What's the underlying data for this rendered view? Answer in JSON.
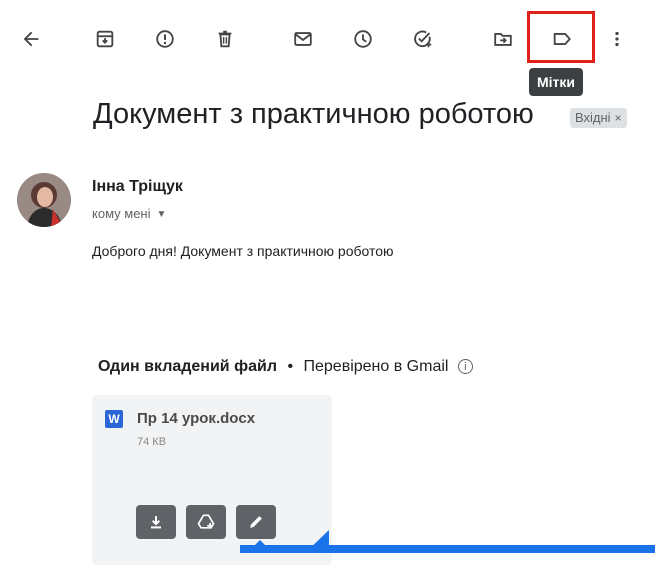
{
  "toolbar": {
    "back": "back-arrow-icon",
    "archive": "archive-icon",
    "report_spam": "report-spam-icon",
    "delete": "trash-icon",
    "mark_unread": "mail-icon",
    "snooze": "clock-icon",
    "add_task": "add-task-icon",
    "move_to": "move-to-folder-icon",
    "labels": "label-icon",
    "more": "more-vert-icon",
    "tooltip": "Мітки",
    "highlight_color": "#e0201b"
  },
  "email": {
    "subject": "Документ з практичною роботою",
    "label_chip": "Вхідні",
    "label_chip_close": "×",
    "sender": "Інна Тріщук",
    "recipient": "кому мені",
    "body": "Доброго дня! Документ з практичною роботою"
  },
  "attachments": {
    "header_bold": "Один вкладений файл",
    "separator": "•",
    "scan_status": "Перевірено в Gmail",
    "info_glyph": "i",
    "file": {
      "type_letter": "W",
      "name": "Пр 14 урок.docx",
      "size": "74 КВ"
    },
    "actions": [
      "download-icon",
      "add-to-drive-icon",
      "edit-icon"
    ]
  },
  "colors": {
    "accent_blue": "#1a73e8",
    "word_blue": "#2b66d9",
    "tooltip_bg": "#3c4043"
  }
}
